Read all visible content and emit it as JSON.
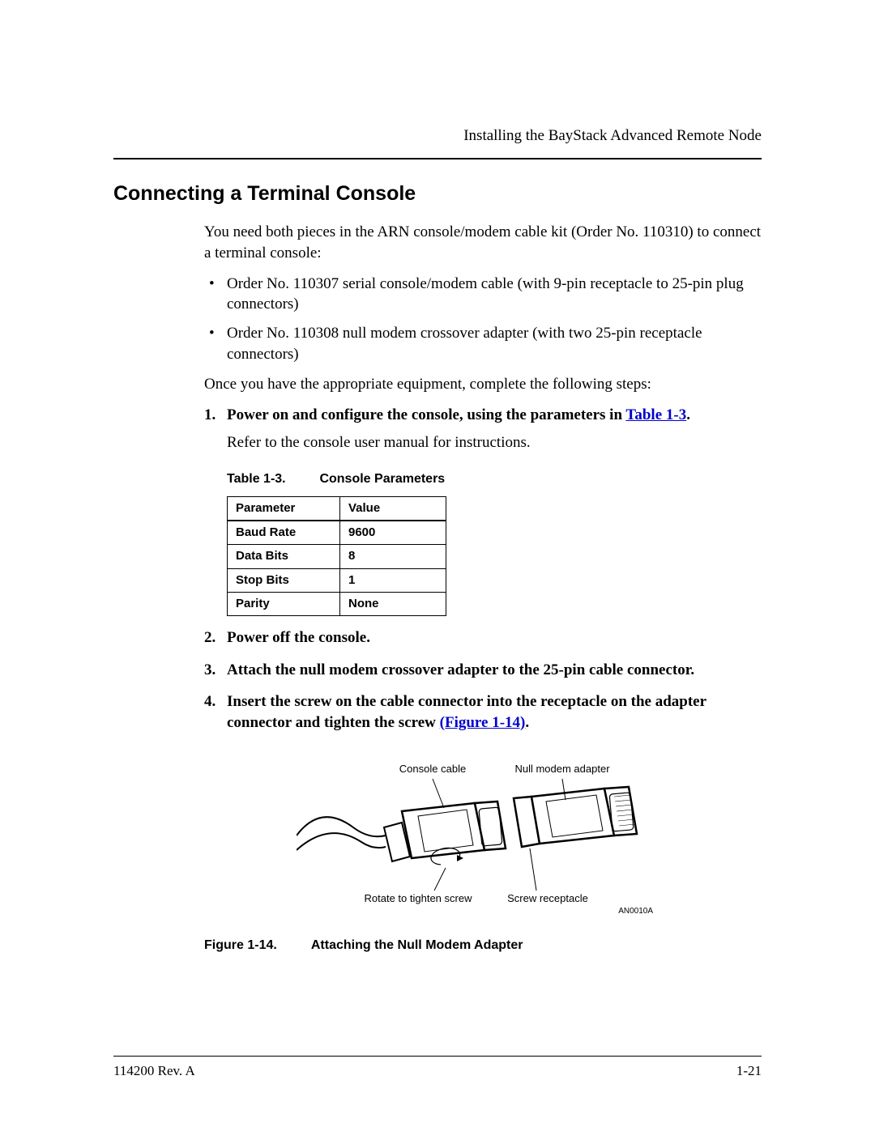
{
  "header": {
    "title": "Installing the BayStack Advanced Remote Node"
  },
  "section": {
    "heading": "Connecting a Terminal Console",
    "intro": "You need both pieces in the ARN console/modem cable kit (Order No. 110310) to connect a terminal console:",
    "bullets": [
      "Order No. 110307 serial console/modem cable (with 9-pin receptacle to 25-pin plug connectors)",
      "Order No. 110308 null modem crossover adapter (with two 25-pin receptacle connectors)"
    ],
    "post_list": "Once you have the appropriate equipment, complete the following steps:",
    "steps": {
      "s1_pre": "Power on and configure the console, using the parameters in ",
      "s1_link": "Table 1-3",
      "s1_post": ".",
      "s1_note": "Refer to the console user manual for instructions.",
      "s2": "Power off the console.",
      "s3": "Attach the null modem crossover adapter to the 25-pin cable connector.",
      "s4_pre": "Insert the screw on the cable connector into the receptacle on the adapter connector and tighten the screw ",
      "s4_link": "(Figure 1-14)",
      "s4_post": "."
    }
  },
  "table": {
    "number": "Table 1-3.",
    "title": "Console Parameters",
    "headers": [
      "Parameter",
      "Value"
    ],
    "rows": [
      [
        "Baud Rate",
        "9600"
      ],
      [
        "Data Bits",
        "8"
      ],
      [
        "Stop Bits",
        "1"
      ],
      [
        "Parity",
        "None"
      ]
    ]
  },
  "figure": {
    "labels": {
      "console_cable": "Console cable",
      "null_modem": "Null modem adapter",
      "rotate": "Rotate to tighten screw",
      "screw_receptacle": "Screw receptacle",
      "art_id": "AN0010A"
    },
    "number": "Figure 1-14.",
    "title": "Attaching the Null Modem Adapter"
  },
  "footer": {
    "left": "114200 Rev. A",
    "right": "1-21"
  }
}
